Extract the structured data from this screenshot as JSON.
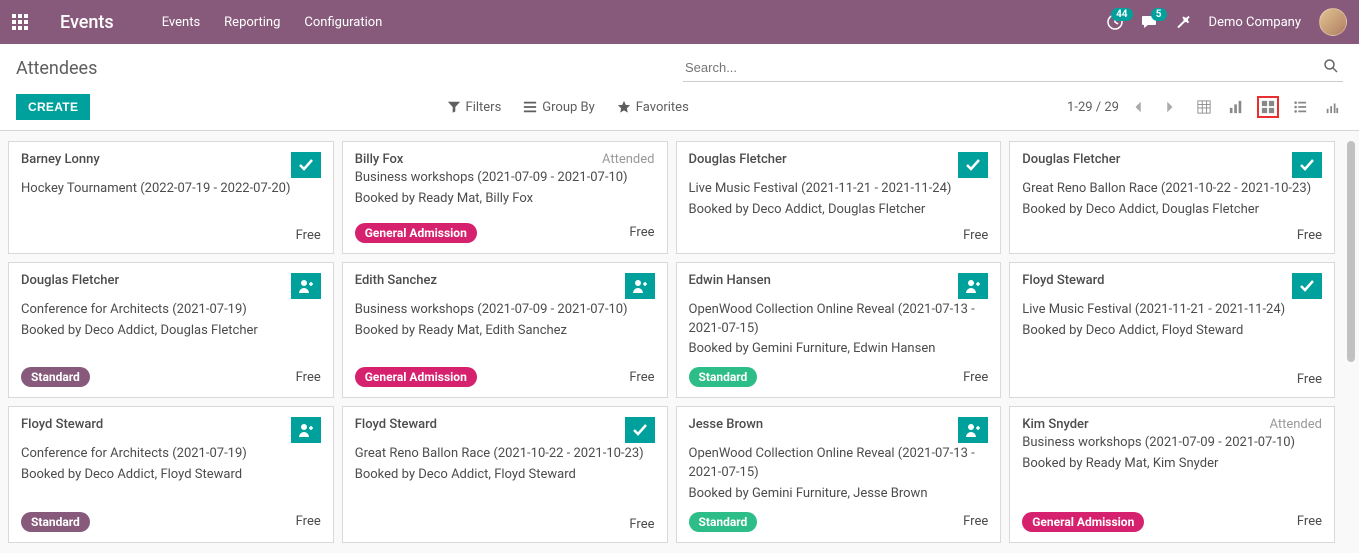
{
  "navbar": {
    "brand": "Events",
    "links": [
      "Events",
      "Reporting",
      "Configuration"
    ],
    "activity_count": "44",
    "message_count": "5",
    "company": "Demo Company"
  },
  "cp": {
    "breadcrumb": "Attendees",
    "search_placeholder": "Search...",
    "btn_create": "CREATE",
    "filters": "Filters",
    "group_by": "Group By",
    "favorites": "Favorites",
    "pager": "1-29 / 29"
  },
  "tag_colors": {
    "General Admission": "tag-pink",
    "Standard": "tag-purple",
    "Standard-green": "tag-green"
  },
  "cards": [
    {
      "name": "Barney Lonny",
      "event": "Hockey Tournament (2022-07-19 - 2022-07-20)",
      "booked": "",
      "status": "check",
      "tag": "",
      "tag_style": "",
      "price": "Free"
    },
    {
      "name": "Billy Fox",
      "event": "Business workshops (2021-07-09 - 2021-07-10)",
      "booked": "Booked by Ready Mat, Billy Fox",
      "status": "Attended",
      "tag": "General Admission",
      "tag_style": "tag-pink",
      "price": "Free"
    },
    {
      "name": "Douglas Fletcher",
      "event": "Live Music Festival (2021-11-21 - 2021-11-24)",
      "booked": "Booked by Deco Addict, Douglas Fletcher",
      "status": "check",
      "tag": "",
      "tag_style": "",
      "price": "Free"
    },
    {
      "name": "Douglas Fletcher",
      "event": "Great Reno Ballon Race (2021-10-22 - 2021-10-23)",
      "booked": "Booked by Deco Addict, Douglas Fletcher",
      "status": "check",
      "tag": "",
      "tag_style": "",
      "price": "Free"
    },
    {
      "name": "Douglas Fletcher",
      "event": "Conference for Architects (2021-07-19)",
      "booked": "Booked by Deco Addict, Douglas Fletcher",
      "status": "person",
      "tag": "Standard",
      "tag_style": "tag-purple",
      "price": "Free"
    },
    {
      "name": "Edith Sanchez",
      "event": "Business workshops (2021-07-09 - 2021-07-10)",
      "booked": "Booked by Ready Mat, Edith Sanchez",
      "status": "person",
      "tag": "General Admission",
      "tag_style": "tag-pink",
      "price": "Free"
    },
    {
      "name": "Edwin Hansen",
      "event": "OpenWood Collection Online Reveal (2021-07-13 - 2021-07-15)",
      "booked": "Booked by Gemini Furniture, Edwin Hansen",
      "status": "person",
      "tag": "Standard",
      "tag_style": "tag-green",
      "price": "Free"
    },
    {
      "name": "Floyd Steward",
      "event": "Live Music Festival (2021-11-21 - 2021-11-24)",
      "booked": "Booked by Deco Addict, Floyd Steward",
      "status": "check",
      "tag": "",
      "tag_style": "",
      "price": "Free"
    },
    {
      "name": "Floyd Steward",
      "event": "Conference for Architects (2021-07-19)",
      "booked": "Booked by Deco Addict, Floyd Steward",
      "status": "person",
      "tag": "Standard",
      "tag_style": "tag-purple",
      "price": "Free"
    },
    {
      "name": "Floyd Steward",
      "event": "Great Reno Ballon Race (2021-10-22 - 2021-10-23)",
      "booked": "Booked by Deco Addict, Floyd Steward",
      "status": "check",
      "tag": "",
      "tag_style": "",
      "price": "Free"
    },
    {
      "name": "Jesse Brown",
      "event": "OpenWood Collection Online Reveal (2021-07-13 - 2021-07-15)",
      "booked": "Booked by Gemini Furniture, Jesse Brown",
      "status": "person",
      "tag": "Standard",
      "tag_style": "tag-green",
      "price": "Free"
    },
    {
      "name": "Kim Snyder",
      "event": "Business workshops (2021-07-09 - 2021-07-10)",
      "booked": "Booked by Ready Mat, Kim Snyder",
      "status": "Attended",
      "tag": "General Admission",
      "tag_style": "tag-pink",
      "price": "Free"
    }
  ]
}
